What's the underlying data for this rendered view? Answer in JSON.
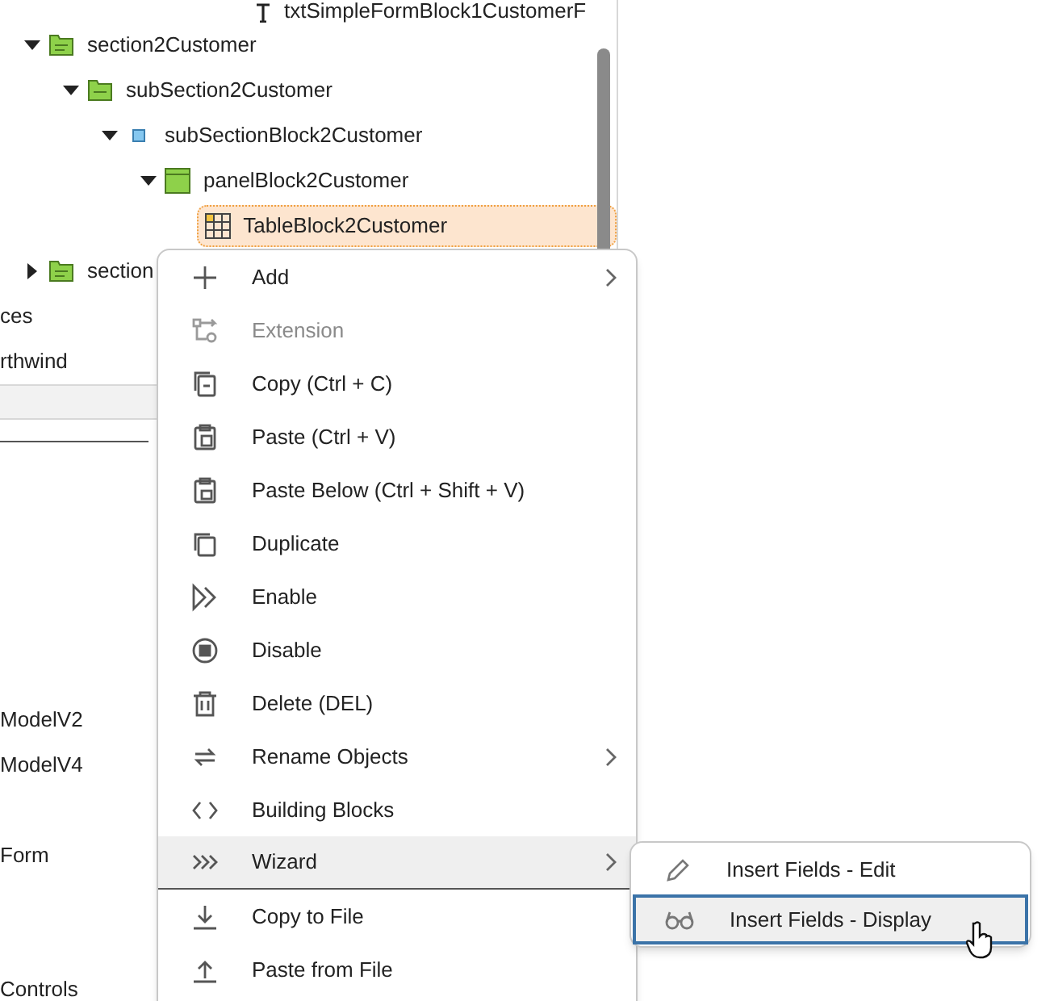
{
  "tree": {
    "top_item": {
      "label": "txtSimpleFormBlock1CustomerF"
    },
    "items": [
      {
        "label": "section2Customer",
        "kind": "section",
        "expanded": true,
        "selected": false,
        "children": [
          {
            "label": "subSection2Customer",
            "kind": "subsection",
            "expanded": true,
            "selected": false,
            "children": [
              {
                "label": "subSectionBlock2Customer",
                "kind": "block",
                "expanded": true,
                "selected": false,
                "children": [
                  {
                    "label": "panelBlock2Customer",
                    "kind": "panel",
                    "expanded": true,
                    "selected": false,
                    "children": [
                      {
                        "label": "TableBlock2Customer",
                        "kind": "table",
                        "selected": true
                      }
                    ]
                  }
                ]
              }
            ]
          }
        ]
      },
      {
        "label": "section",
        "kind": "section",
        "expanded": false,
        "selected": false
      }
    ],
    "partial_items": [
      {
        "label": "ces"
      },
      {
        "label": "rthwind"
      }
    ]
  },
  "lower_list": [
    {
      "label": "ModelV2"
    },
    {
      "label": "ModelV4"
    },
    {
      "label": "Form"
    },
    {
      "label": "Controls"
    }
  ],
  "context_menu": [
    {
      "label": "Add",
      "disabled": false,
      "submenu": true,
      "selected": false
    },
    {
      "label": "Extension",
      "disabled": true,
      "submenu": false,
      "selected": false
    },
    {
      "label": "Copy (Ctrl + C)",
      "disabled": false,
      "submenu": false,
      "selected": false
    },
    {
      "label": "Paste (Ctrl + V)",
      "disabled": false,
      "submenu": false,
      "selected": false
    },
    {
      "label": "Paste Below (Ctrl + Shift + V)",
      "disabled": false,
      "submenu": false,
      "selected": false
    },
    {
      "label": "Duplicate",
      "disabled": false,
      "submenu": false,
      "selected": false
    },
    {
      "label": "Enable",
      "disabled": false,
      "submenu": false,
      "selected": false
    },
    {
      "label": "Disable",
      "disabled": false,
      "submenu": false,
      "selected": false
    },
    {
      "label": "Delete (DEL)",
      "disabled": false,
      "submenu": false,
      "selected": false
    },
    {
      "label": "Rename Objects",
      "disabled": false,
      "submenu": true,
      "selected": false
    },
    {
      "label": "Building Blocks",
      "disabled": false,
      "submenu": false,
      "selected": false
    },
    {
      "label": "Wizard",
      "disabled": false,
      "submenu": true,
      "selected": true
    },
    {
      "label": "Copy to File",
      "disabled": false,
      "submenu": false,
      "selected": false
    },
    {
      "label": "Paste from File",
      "disabled": false,
      "submenu": false,
      "selected": false
    }
  ],
  "submenu": [
    {
      "label": "Insert Fields - Edit",
      "selected": false
    },
    {
      "label": "Insert Fields - Display",
      "selected": true
    }
  ]
}
